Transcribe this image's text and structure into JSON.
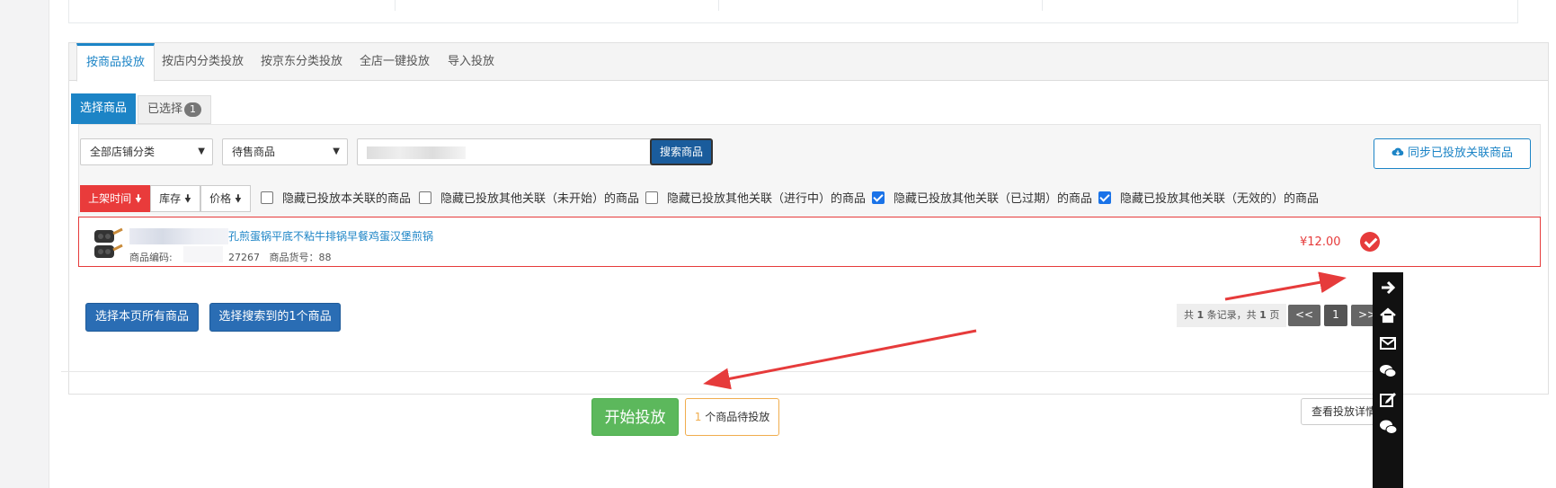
{
  "tabs": [
    {
      "label": "按商品投放",
      "active": true
    },
    {
      "label": "按店内分类投放",
      "active": false
    },
    {
      "label": "按京东分类投放",
      "active": false
    },
    {
      "label": "全店一键投放",
      "active": false
    },
    {
      "label": "导入投放",
      "active": false
    }
  ],
  "subtabs": {
    "select": "选择商品",
    "selected": "已选择",
    "selected_count": "1"
  },
  "filters": {
    "category_select": "全部店铺分类",
    "status_select": "待售商品",
    "search_button": "搜索商品",
    "sync_button": "同步已投放关联商品"
  },
  "sort": {
    "listing_time": "上架时间",
    "stock": "库存",
    "price": "价格"
  },
  "checkboxes": [
    {
      "label": "隐藏已投放本关联的商品",
      "checked": false
    },
    {
      "label": "隐藏已投放其他关联（未开始）的商品",
      "checked": false
    },
    {
      "label": "隐藏已投放其他关联（进行中）的商品",
      "checked": false
    },
    {
      "label": "隐藏已投放其他关联（已过期）的商品",
      "checked": true
    },
    {
      "label": "隐藏已投放其他关联（无效的）的商品",
      "checked": true
    }
  ],
  "product": {
    "title": "孔煎蛋锅平底不粘牛排锅早餐鸡蛋汉堡煎锅",
    "code_label": "商品编码:",
    "code_suffix": "27267",
    "item_number": "商品货号：88",
    "price": "¥12.00",
    "selected": true
  },
  "actions": {
    "select_page": "选择本页所有商品",
    "select_searched": "选择搜索到的1个商品"
  },
  "pagination": {
    "info_prefix": "共",
    "records": "1",
    "info_mid": "条记录，共",
    "pages": "1",
    "info_suffix": "页",
    "prev": "<<",
    "current": "1",
    "next": ">>"
  },
  "footer": {
    "start_button": "开始投放",
    "pending_count": "1",
    "pending_text": " 个商品待投放",
    "detail_button": "查看投放详情"
  },
  "colors": {
    "primary": "#1c84c6",
    "danger": "#e63b3b",
    "success": "#5cb85c",
    "warning": "#f0ad4e",
    "sidebar": "#111111"
  },
  "sidebar_icons": [
    "arrow-right-icon",
    "home-icon",
    "envelope-icon",
    "comments-icon",
    "edit-icon",
    "wechat-icon"
  ]
}
